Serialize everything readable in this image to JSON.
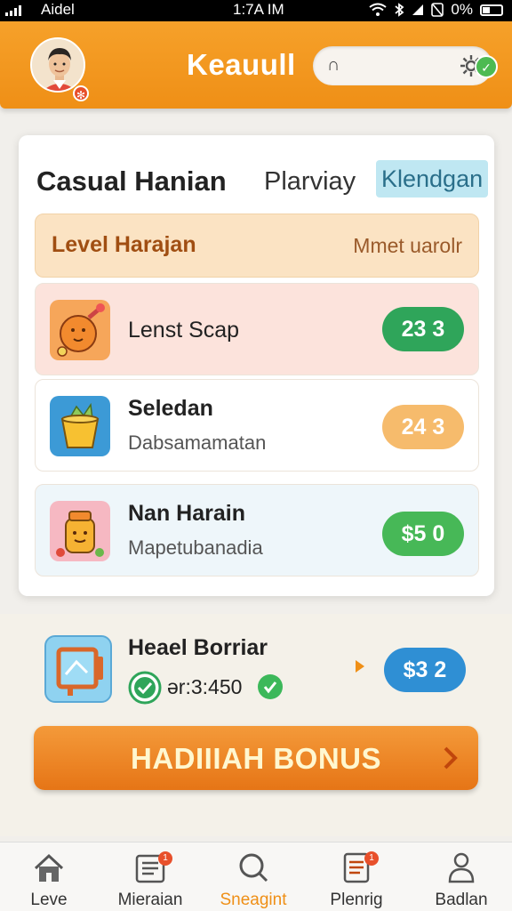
{
  "status_bar": {
    "carrier": "Aidel",
    "time": "1:7A IM",
    "battery": "0%"
  },
  "header": {
    "title": "Keauull",
    "search_value": "∩",
    "notification_count": "✓"
  },
  "card": {
    "title": "Casual Hanian",
    "tab_2": "Plarviay",
    "tab_3": "Klendgan",
    "level_row": {
      "label": "Level Harajan",
      "right": "Mmet uarolr"
    },
    "tasks": [
      {
        "name": "Lenst Scap",
        "sub": "",
        "value": "23 3",
        "color": "#2fa55a"
      },
      {
        "name": "Seledan",
        "sub": "Dabsamamatan",
        "value": "24 3",
        "color": "#f6bb6c"
      },
      {
        "name": "Nan Harain",
        "sub": "Mapetubanadia",
        "value": "$5 0",
        "color": "#47b857"
      }
    ]
  },
  "bonus_task": {
    "name": "Heael Borriar",
    "code": "ər:3:450",
    "value": "$3 2"
  },
  "bonus_button": {
    "label": "HADIIIAH BONUS"
  },
  "nav": [
    {
      "label": "Leve",
      "icon": "home-icon"
    },
    {
      "label": "Mieraian",
      "icon": "list-icon",
      "badge": "1"
    },
    {
      "label": "Sneagint",
      "icon": "search-icon",
      "active": true
    },
    {
      "label": "Plenrig",
      "icon": "document-icon",
      "badge": "1"
    },
    {
      "label": "Badlan",
      "icon": "user-icon"
    }
  ],
  "colors": {
    "brand_orange": "#ef8f16",
    "green": "#2fa55a",
    "blue": "#2f8fd4"
  }
}
